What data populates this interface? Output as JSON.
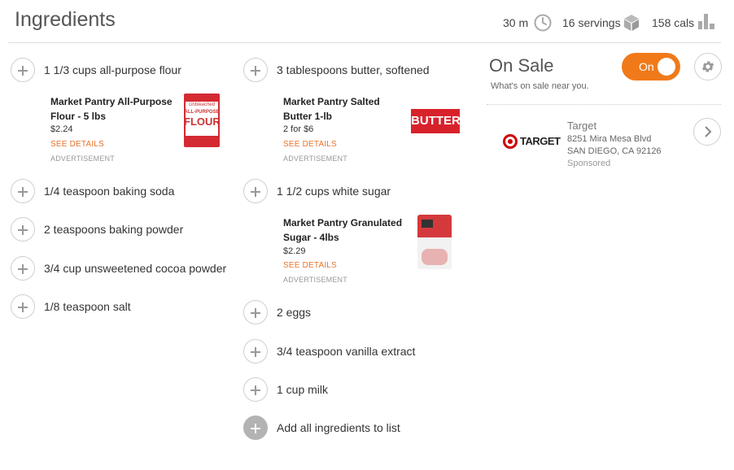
{
  "header": {
    "title": "Ingredients",
    "time": "30 m",
    "servings": "16 servings",
    "calories": "158 cals"
  },
  "ingredients_col1": [
    "1 1/3 cups all-purpose flour",
    "1/4 teaspoon baking soda",
    "2 teaspoons baking powder",
    "3/4 cup unsweetened cocoa powder",
    "1/8 teaspoon salt"
  ],
  "ingredients_col2": [
    "3 tablespoons butter, softened",
    "1 1/2 cups white sugar",
    "2 eggs",
    "3/4 teaspoon vanilla extract",
    "1 cup milk"
  ],
  "add_all_label": "Add all ingredients to list",
  "ads": [
    {
      "name": "Market Pantry All-Purpose Flour - 5 lbs",
      "price": "$2.24",
      "link": "SEE DETAILS",
      "tag": "ADVERTISEMENT",
      "image_text": "FLOUR",
      "image_small": "Unbleached",
      "image_mid": "ALL-PURPOSE"
    },
    {
      "name": "Market Pantry Salted Butter 1-lb",
      "price": "2 for $6",
      "link": "SEE DETAILS",
      "tag": "ADVERTISEMENT",
      "image_text": "BUTTER"
    },
    {
      "name": "Market Pantry Granulated Sugar - 4lbs",
      "price": "$2.29",
      "link": "SEE DETAILS",
      "tag": "ADVERTISEMENT"
    }
  ],
  "sale": {
    "title": "On Sale",
    "subtitle": "What's on sale near you.",
    "toggle_label": "On",
    "toggle_on": true,
    "store": {
      "logo_text": "TARGET",
      "name": "Target",
      "address1": "8251 Mira Mesa Blvd",
      "address2": "SAN DIEGO, CA 92126",
      "sponsored": "Sponsored"
    }
  },
  "colors": {
    "accent": "#f07a1a",
    "target_red": "#cc0000",
    "link": "#e8732b"
  },
  "icons": [
    "clock-icon",
    "cube-icon",
    "bar-chart-icon",
    "plus-icon",
    "gear-icon",
    "chevron-right-icon",
    "target-logo"
  ]
}
